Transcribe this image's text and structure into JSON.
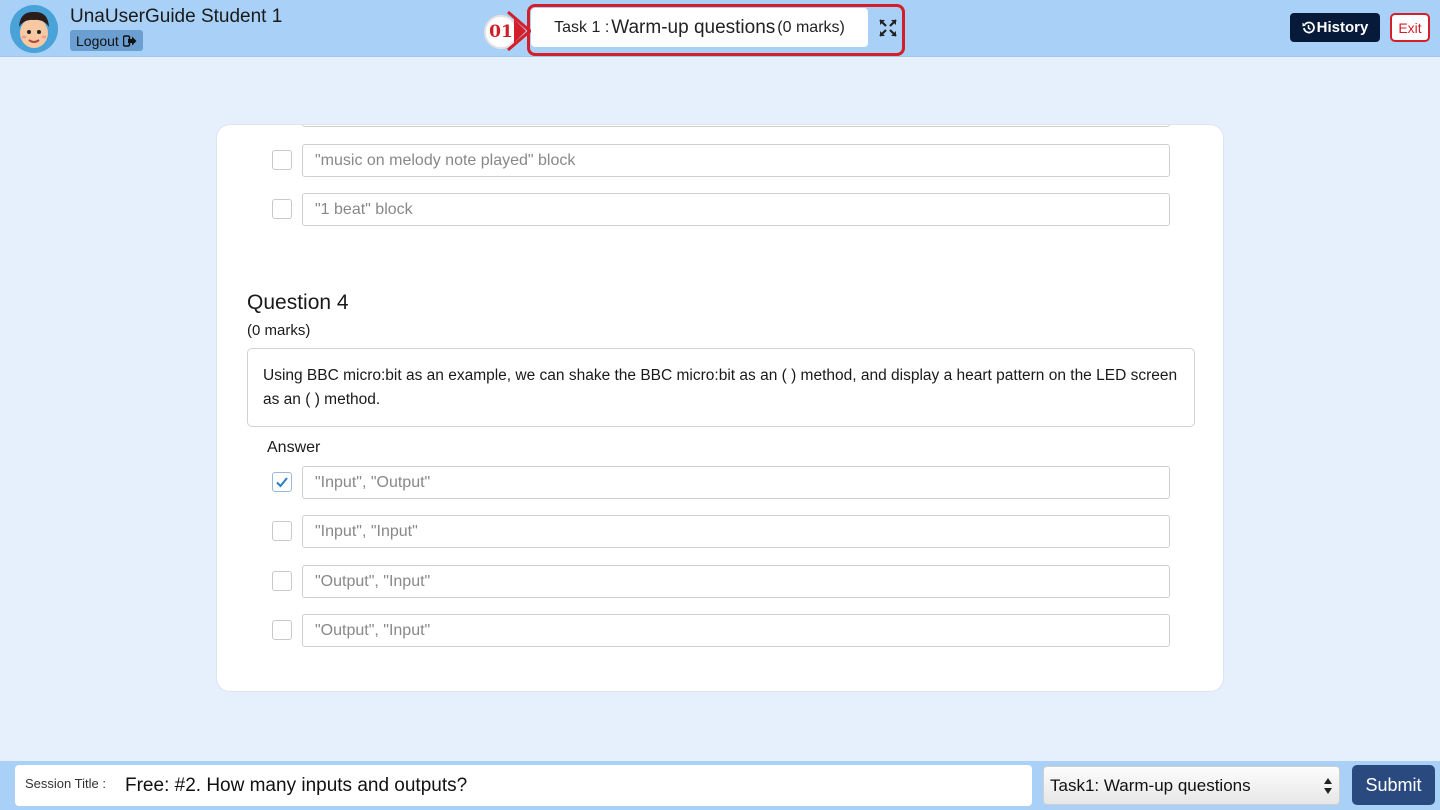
{
  "header": {
    "user_name": "UnaUserGuide Student 1",
    "logout_label": "Logout",
    "step_badge": "01",
    "task_prefix": "Task 1 :",
    "task_name": "Warm-up questions",
    "task_marks": "(0 marks)",
    "history_label": "History",
    "exit_label": "Exit"
  },
  "previous_options": [
    "\"music on melody note played\" block",
    "\"1 beat\" block"
  ],
  "question": {
    "title": "Question 4",
    "marks": "(0 marks)",
    "text": "Using BBC micro:bit as an example, we can shake the BBC micro:bit as an ( ) method, and display a heart pattern on the LED screen as an ( ) method.",
    "answer_label": "Answer",
    "options": [
      {
        "text": "\"Input\", \"Output\"",
        "checked": true
      },
      {
        "text": "\"Input\", \"Input\"",
        "checked": false
      },
      {
        "text": "\"Output\", \"Input\"",
        "checked": false
      },
      {
        "text": "\"Output\", \"Input\"",
        "checked": false
      }
    ]
  },
  "footer": {
    "session_label": "Session Title :",
    "session_value": "Free: #2. How many inputs and outputs?",
    "task_select_value": "Task1: Warm-up questions",
    "submit_label": "Submit"
  },
  "colors": {
    "header_bg": "#a9d1f7",
    "page_bg": "#e6f0fc",
    "highlight_red": "#d41f2b",
    "history_bg": "#081a3a",
    "submit_bg": "#2a4a7f"
  },
  "icons": [
    "avatar",
    "logout-icon",
    "expand-icon",
    "history-icon",
    "check-icon",
    "select-arrows-icon",
    "pointer-arrow-icon"
  ]
}
